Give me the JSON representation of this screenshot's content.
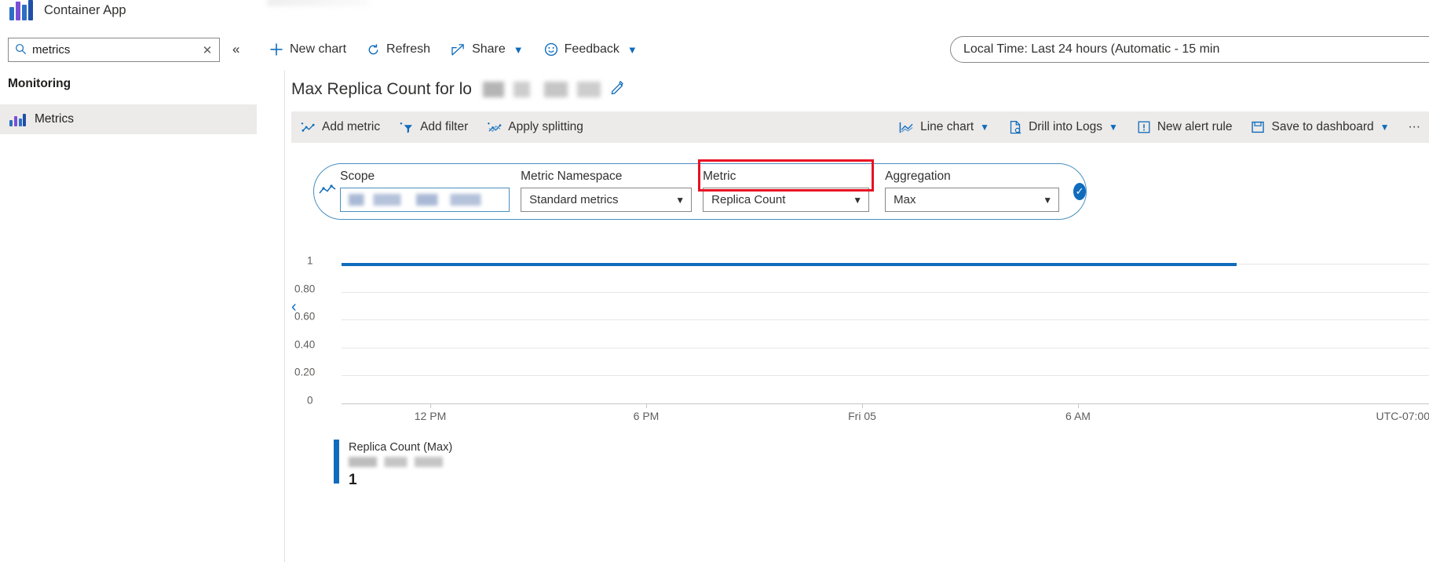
{
  "sidebar": {
    "resource_icon": "container-app-icon",
    "resource_title": "Container App",
    "search": {
      "value": "metrics",
      "placeholder": "Search",
      "icon": "search-icon",
      "clear_icon": "close-icon"
    },
    "collapse_icon": "double-chevron-left-icon",
    "group_title": "Monitoring",
    "items": [
      {
        "label": "Metrics",
        "icon": "metrics-chart-icon",
        "selected": true
      }
    ]
  },
  "commandbar": {
    "items": [
      {
        "label": "New chart",
        "icon": "plus-icon",
        "has_caret": false
      },
      {
        "label": "Refresh",
        "icon": "refresh-icon",
        "has_caret": false
      },
      {
        "label": "Share",
        "icon": "share-icon",
        "has_caret": true
      },
      {
        "label": "Feedback",
        "icon": "smiley-icon",
        "has_caret": true
      }
    ],
    "time_picker": {
      "label": "Local Time: Last 24 hours (Automatic - 15 min",
      "icon": "clock-icon"
    }
  },
  "chart": {
    "title": "Max Replica Count for lo",
    "title_redacted": true,
    "edit_icon": "pencil-icon",
    "toolbar_left": [
      {
        "label": "Add metric",
        "icon": "add-metric-icon",
        "has_caret": false
      },
      {
        "label": "Add filter",
        "icon": "add-filter-icon",
        "has_caret": false
      },
      {
        "label": "Apply splitting",
        "icon": "apply-splitting-icon",
        "has_caret": false
      }
    ],
    "toolbar_right": [
      {
        "label": "Line chart",
        "icon": "line-chart-icon",
        "has_caret": true
      },
      {
        "label": "Drill into Logs",
        "icon": "logs-icon",
        "has_caret": true
      },
      {
        "label": "New alert rule",
        "icon": "alert-icon",
        "has_caret": false
      },
      {
        "label": "Save to dashboard",
        "icon": "save-icon",
        "has_caret": true
      }
    ],
    "overflow_label": "···",
    "collapse_icon": "chevron-left-icon"
  },
  "selector": {
    "icon": "metric-line-icon",
    "fields": [
      {
        "name": "Scope",
        "value": "",
        "redacted": true,
        "caret": false
      },
      {
        "name": "Metric Namespace",
        "value": "Standard metrics",
        "redacted": false,
        "caret": true
      },
      {
        "name": "Metric",
        "value": "Replica Count",
        "redacted": false,
        "caret": true,
        "highlighted": true
      },
      {
        "name": "Aggregation",
        "value": "Max",
        "redacted": false,
        "caret": true
      }
    ],
    "confirm_icon": "check-circle-icon"
  },
  "chart_data": {
    "type": "line",
    "title": "Max Replica Count for lo",
    "xlabel": "",
    "ylabel": "",
    "ylim": [
      0,
      1
    ],
    "ytick_labels": [
      "1",
      "0.80",
      "0.60",
      "0.40",
      "0.20",
      "0"
    ],
    "ytick_values": [
      1,
      0.8,
      0.6,
      0.4,
      0.2,
      0
    ],
    "xtick_labels": [
      "12 PM",
      "6 PM",
      "Fri 05",
      "6 AM"
    ],
    "timezone_label": "UTC-07:00",
    "grid": true,
    "legend_position": "bottom-left",
    "series": [
      {
        "name": "Replica Count (Max)",
        "resource_redacted": true,
        "color": "#0f6cbd",
        "current_value": "1",
        "values": [
          1,
          1,
          1,
          1,
          1,
          1,
          1,
          1,
          1,
          1,
          1,
          1,
          1,
          1,
          1,
          1,
          1,
          1,
          1,
          1,
          1,
          1,
          1,
          1
        ]
      }
    ]
  }
}
